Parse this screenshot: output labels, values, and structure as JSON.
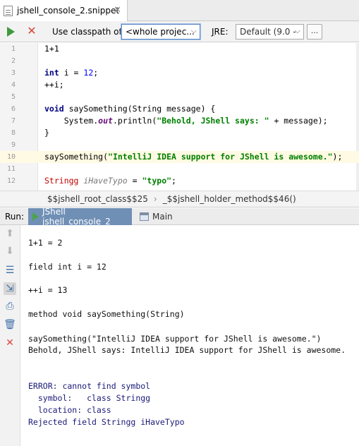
{
  "tab": {
    "label": "jshell_console_2.snippet",
    "close": "✕"
  },
  "toolbar": {
    "classpath_label": "Use classpath of:",
    "classpath_value": "<whole projec...",
    "jre_label_prefix": "J",
    "jre_label_rest": "RE:",
    "jre_value": "Default (9.0 -",
    "more": "..."
  },
  "editor": {
    "lines": [
      {
        "n": "1",
        "text": "1+1"
      },
      {
        "n": "2",
        "text": ""
      },
      {
        "n": "3",
        "text": "int i = 12;"
      },
      {
        "n": "4",
        "text": "++i;"
      },
      {
        "n": "5",
        "text": ""
      },
      {
        "n": "6",
        "text": "void saySomething(String message) {"
      },
      {
        "n": "7",
        "text": "    System.out.println(\"Behold, JShell says: \" + message);"
      },
      {
        "n": "8",
        "text": "}"
      },
      {
        "n": "9",
        "text": ""
      },
      {
        "n": "10",
        "text": "saySomething(\"IntelliJ IDEA support for JShell is awesome.\");"
      },
      {
        "n": "11",
        "text": ""
      },
      {
        "n": "12",
        "text": "Stringg iHaveTypo = \"typo\";"
      }
    ],
    "current_line": "10"
  },
  "breadcrumb": {
    "items": [
      "$$jshell_root_class$$25",
      "_$$jshell_holder_method$$46()"
    ]
  },
  "run": {
    "label": "Run:",
    "tabs": [
      {
        "label": "JShell jshell_console_2"
      },
      {
        "label": "Main"
      }
    ]
  },
  "console": {
    "lines": [
      "1+1 = 2",
      "field int i = 12",
      "++i = 13",
      "method void saySomething(String)",
      "saySomething(\"IntelliJ IDEA support for JShell is awesome.\")",
      "Behold, JShell says: IntelliJ IDEA support for JShell is awesome.",
      "ERROR: cannot find symbol",
      "  symbol:   class Stringg",
      "  location: class",
      "Rejected field Stringg iHaveTypo"
    ]
  }
}
